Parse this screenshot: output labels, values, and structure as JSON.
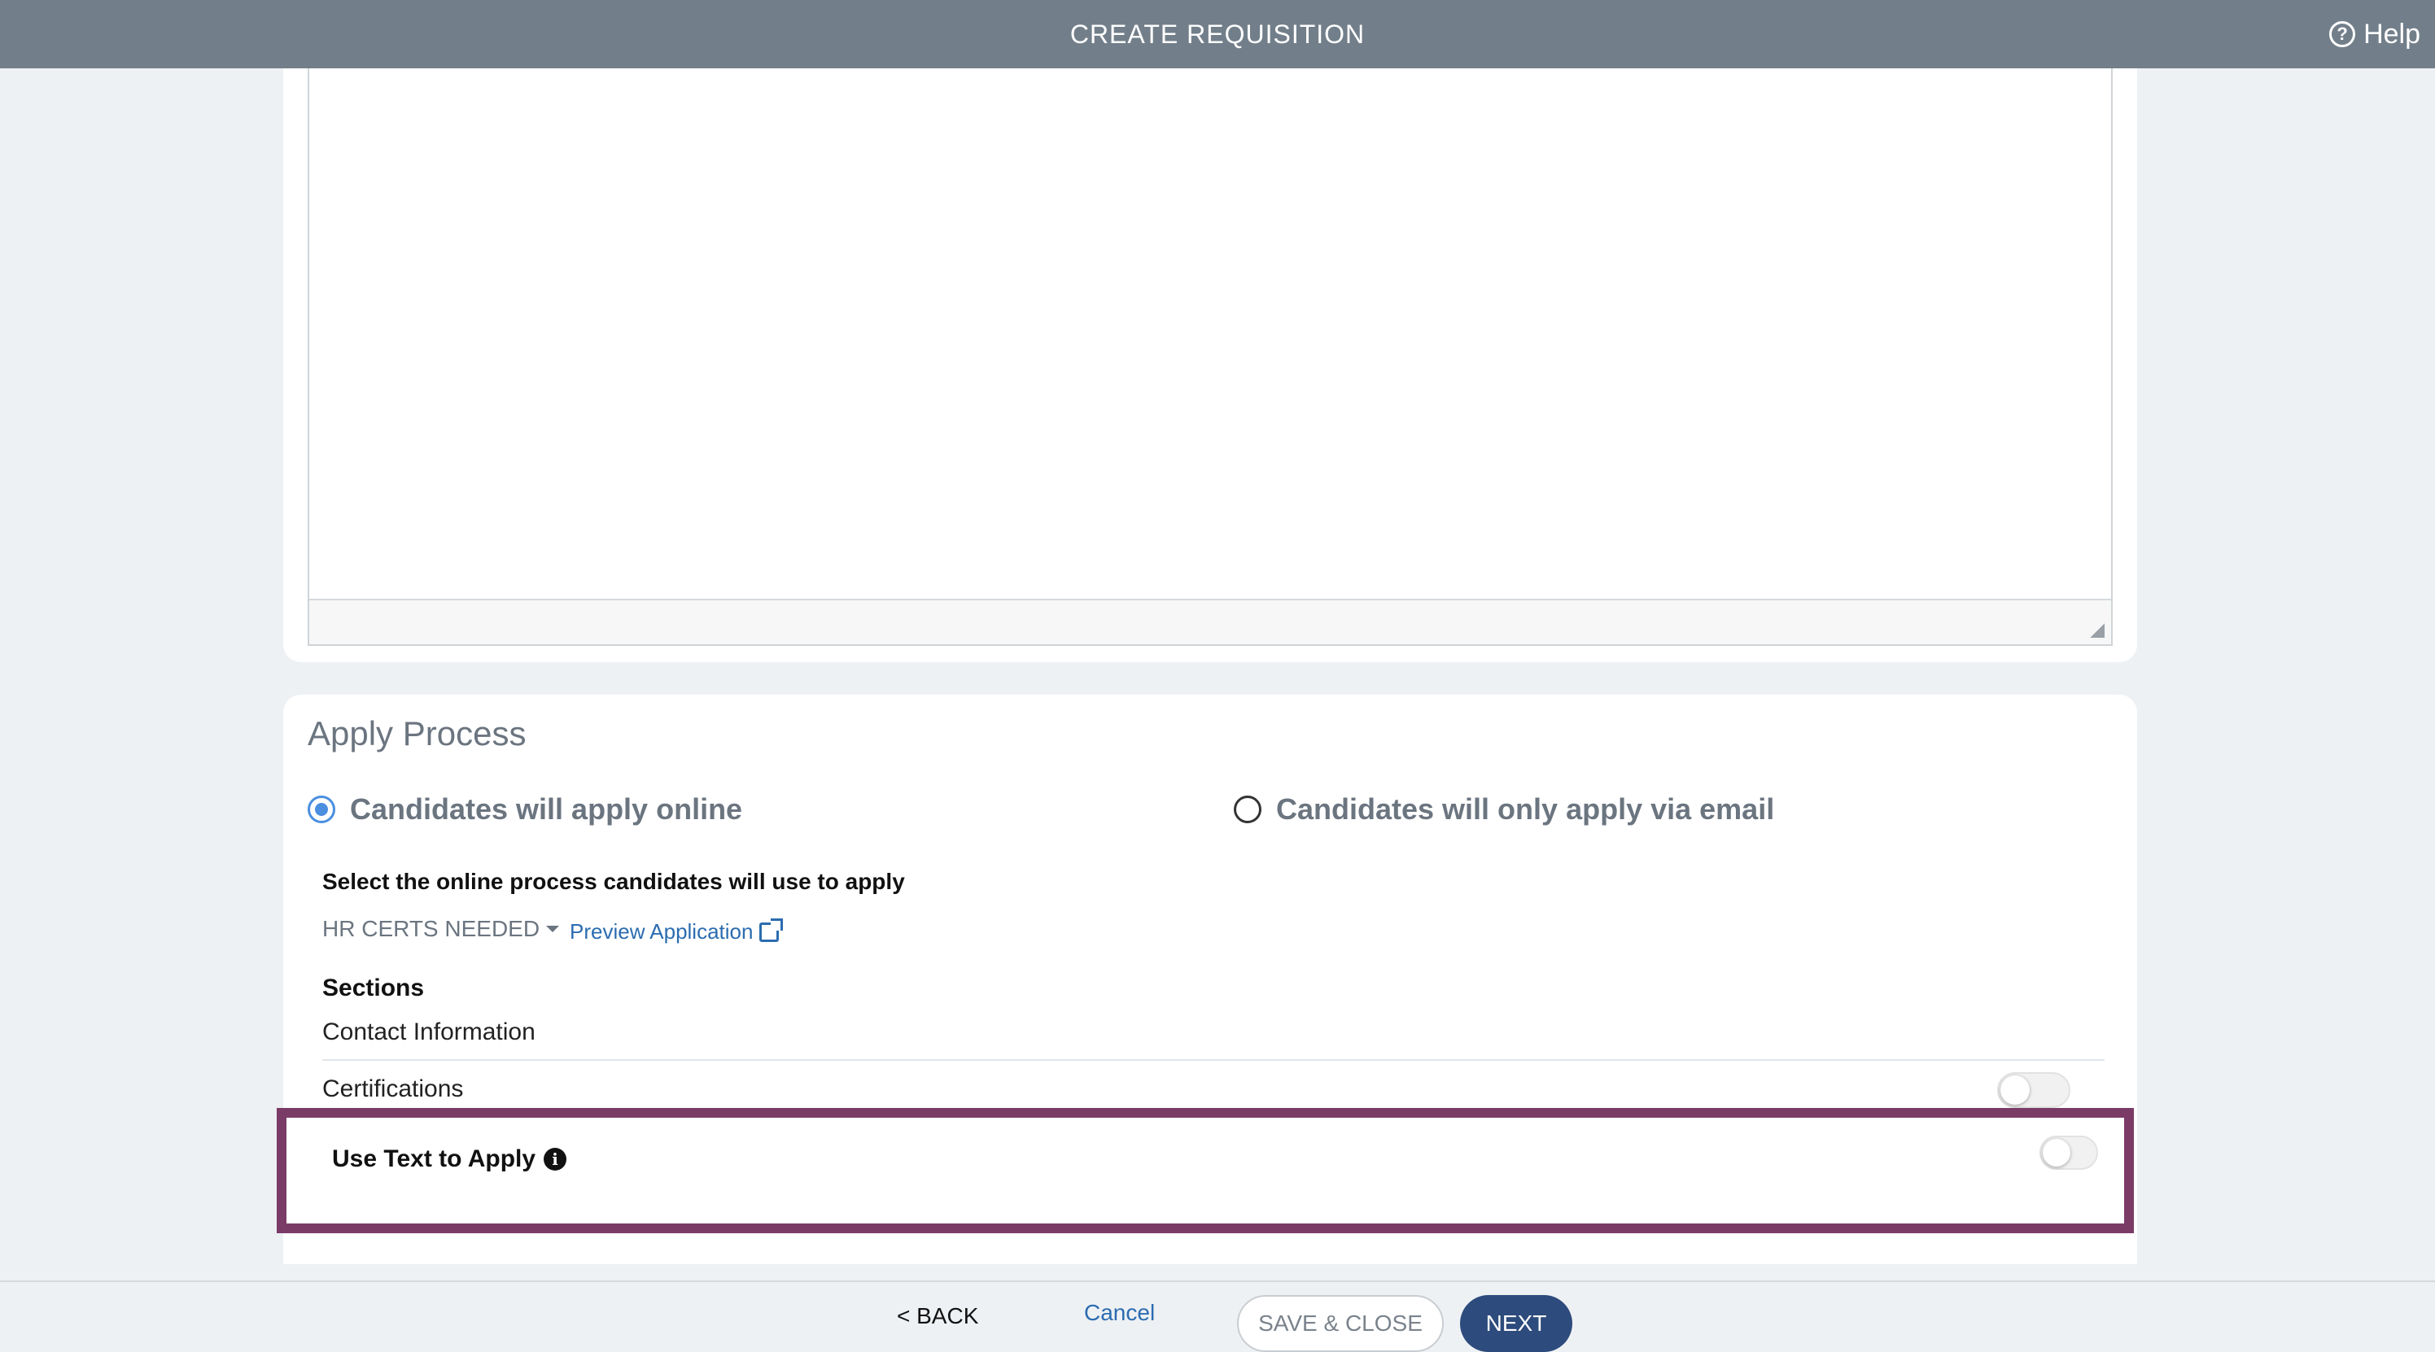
{
  "header": {
    "title": "CREATE REQUISITION",
    "help_label": "Help",
    "help_icon": "help-circle-icon"
  },
  "apply_process": {
    "title": "Apply Process",
    "options": [
      {
        "label": "Candidates will apply online",
        "selected": true
      },
      {
        "label": "Candidates will only apply via email",
        "selected": false
      }
    ],
    "select_label": "Select the online process candidates will use to apply",
    "process_value": "HR CERTS NEEDED",
    "preview_link": "Preview Application",
    "sections_label": "Sections",
    "sections": [
      {
        "label": "Contact Information"
      },
      {
        "label": "Certifications",
        "toggle_on": false
      }
    ],
    "text_to_apply": {
      "label": "Use Text to Apply",
      "toggle_on": false
    }
  },
  "footer": {
    "back_label": "< BACK",
    "cancel_label": "Cancel",
    "save_close_label": "SAVE & CLOSE",
    "next_label": "NEXT"
  },
  "colors": {
    "header_bg": "#727f8a",
    "highlight_border": "#7b3b67",
    "primary_button": "#2d4b7c",
    "link": "#2b6cb0",
    "radio_selected": "#4a8fe0"
  }
}
